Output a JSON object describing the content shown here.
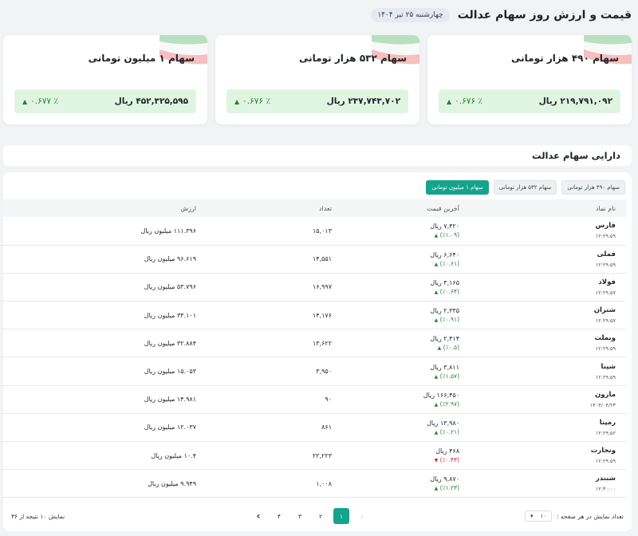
{
  "header": {
    "title": "قیمت و ارزش روز سهام عدالت",
    "date": "چهارشنبه ۲۵ تیر ۱۴۰۴"
  },
  "cards": [
    {
      "title": "سهام ۴۹۰ هزار تومانی",
      "value": "۲۱۹,۷۹۱,۰۹۲ ریال",
      "change": "٪ ۰.۶۷۶"
    },
    {
      "title": "سهام ۵۳۲ هزار تومانی",
      "value": "۲۳۷,۷۴۳,۷۰۲ ریال",
      "change": "٪ ۰.۶۷۶"
    },
    {
      "title": "سهام ۱ میلیون تومانی",
      "value": "۴۵۲,۳۲۵,۵۹۵ ریال",
      "change": "٪ ۰.۶۷۷"
    }
  ],
  "section": {
    "title": "دارایی سهام عدالت"
  },
  "tabs": [
    {
      "label": "سهام ۴۹۰ هزار تومانی",
      "active": false
    },
    {
      "label": "سهام ۵۳۲ هزار تومانی",
      "active": false
    },
    {
      "label": "سهام ۱ میلیون تومانی",
      "active": true
    }
  ],
  "table": {
    "headers": {
      "name": "نام نماد",
      "price": "آخرین قیمت",
      "count": "تعداد",
      "value": "ارزش"
    },
    "rows": [
      {
        "name": "فارس",
        "time": "۱۲:۲۹:۵۹",
        "price": "۷,۴۲۰ ریال",
        "change": "(٪۱.۰۹)",
        "dir": "up",
        "count": "۱۵,۰۱۳",
        "value": "۱۱۱.۳۹۶ میلیون ریال"
      },
      {
        "name": "فملی",
        "time": "۱۲:۲۹:۵۹",
        "price": "۶,۶۴۰ ریال",
        "change": "(٪۰.۶۱)",
        "dir": "up",
        "count": "۱۴,۵۵۱",
        "value": "۹۶.۶۱۹ میلیون ریال"
      },
      {
        "name": "فولاد",
        "time": "۱۲:۲۹:۵۷",
        "price": "۳,۱۶۵ ریال",
        "change": "(٪۰.۶۴)",
        "dir": "up",
        "count": "۱۶,۹۹۷",
        "value": "۵۳.۷۹۶ میلیون ریال"
      },
      {
        "name": "شتران",
        "time": "۱۲:۲۹:۵۷",
        "price": "۲,۳۳۵ ریال",
        "change": "(٪۰.۹۱)",
        "dir": "up",
        "count": "۱۴,۱۷۶",
        "value": "۳۳.۱۰۱ میلیون ریال"
      },
      {
        "name": "وبملت",
        "time": "۱۲:۲۹:۵۹",
        "price": "۲,۴۱۴ ریال",
        "change": "(٪۰.۵)",
        "dir": "up",
        "count": "۱۳,۶۲۲",
        "value": "۳۲.۸۸۴ میلیون ریال"
      },
      {
        "name": "شپنا",
        "time": "۱۲:۲۹:۵۹",
        "price": "۳,۸۱۱ ریال",
        "change": "(٪۱.۵۷)",
        "dir": "up",
        "count": "۳,۹۵۰",
        "value": "۱۵.۰۵۳ میلیون ریال"
      },
      {
        "name": "مارون",
        "time": "۱۴۰۴/۰۴/۲۳",
        "price": "۱۶۶,۴۵۰ ریال",
        "change": "(٪۲.۹۷)",
        "dir": "up",
        "count": "۹۰",
        "value": "۱۴.۹۸۱ میلیون ریال"
      },
      {
        "name": "رمپنا",
        "time": "۱۲:۲۹:۵۲",
        "price": "۱۳,۹۸۰ ریال",
        "change": "(٪۰.۲۱)",
        "dir": "up",
        "count": "۸۶۱",
        "value": "۱۲.۰۳۷ میلیون ریال"
      },
      {
        "name": "ونجارت",
        "time": "۱۲:۲۹:۵۹",
        "price": "۴۶۸ ریال",
        "change": "(٪۰.۴۳)",
        "dir": "down",
        "count": "۲۲,۲۲۳",
        "value": "۱۰.۴ میلیون ریال"
      },
      {
        "name": "شبندر",
        "time": "۱۲:۳۰:۰۰",
        "price": "۹,۸۷۰ ریال",
        "change": "(٪۱.۲۳)",
        "dir": "up",
        "count": "۱,۰۰۸",
        "value": "۹.۹۴۹ میلیون ریال"
      }
    ]
  },
  "pager": {
    "per_page_label": "تعداد نمایش در هر صفحه :",
    "per_page": "۱۰",
    "pages": [
      "۱",
      "۲",
      "۳",
      "۴"
    ],
    "summary": "نمایش ۱۰ نتیجه از ۳۶"
  },
  "colors": {
    "accent": "#14a38b",
    "up": "#2e7d32",
    "down": "#c62828",
    "strip": "#dff5e2"
  }
}
